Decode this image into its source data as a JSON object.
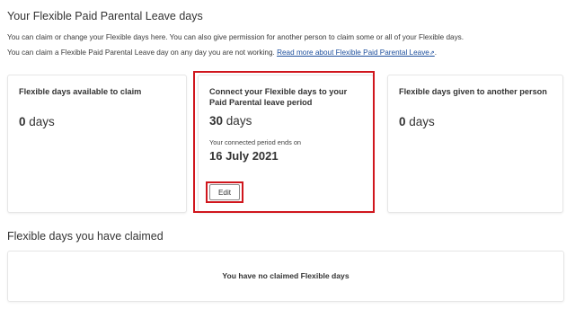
{
  "section_title": "Your Flexible Paid Parental Leave days",
  "intro": {
    "line1": "You can claim or change your Flexible days here. You can also give permission for another person to claim some or all of your Flexible days.",
    "line2_prefix": "You can claim a Flexible Paid Parental Leave day on any day you are not working.",
    "link_text": "Read more about Flexible Paid Parental Leave",
    "link_icon": "external-link-icon",
    "line2_suffix": "."
  },
  "cards": {
    "available": {
      "title": "Flexible days available to claim",
      "value": "0",
      "unit": "days"
    },
    "connect": {
      "title": "Connect your Flexible days to your Paid Parental leave period",
      "value": "30",
      "unit": "days",
      "period_label": "Your connected period ends on",
      "period_end": "16 July 2021",
      "edit_label": "Edit"
    },
    "given": {
      "title": "Flexible days given to another person",
      "value": "0",
      "unit": "days"
    }
  },
  "claimed": {
    "title": "Flexible days you have claimed",
    "empty_message": "You have no claimed Flexible days"
  },
  "colors": {
    "highlight": "#d0161d",
    "link": "#1c4e9c",
    "text": "#333333"
  }
}
